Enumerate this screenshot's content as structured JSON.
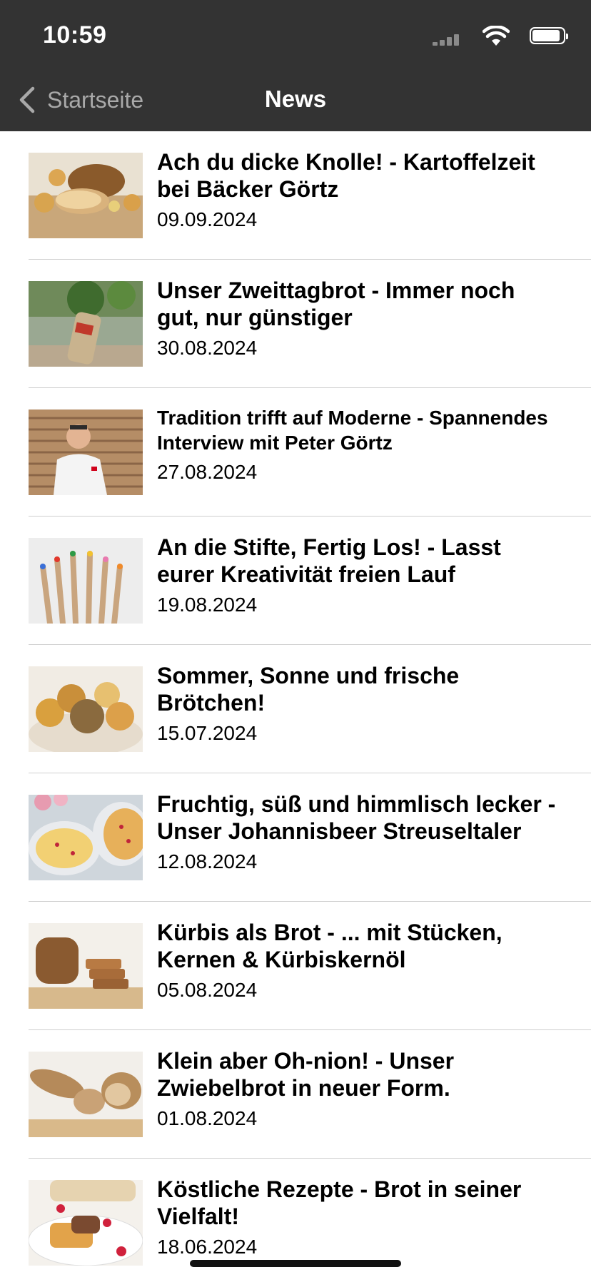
{
  "status_bar": {
    "time": "10:59"
  },
  "nav": {
    "back_label": "Startseite",
    "title": "News"
  },
  "articles": [
    {
      "title": "Ach du dicke Knolle! - Kartoffelzeit bei Bäcker Görtz",
      "date": "09.09.2024",
      "image": "bread-potatoes-image"
    },
    {
      "title": "Unser Zweittagbrot - Immer noch gut, nur günstiger",
      "date": "30.08.2024",
      "image": "bagged-bread-image"
    },
    {
      "title": "Tradition trifft auf Moderne - Spannendes Interview mit Peter Görtz",
      "date": "27.08.2024",
      "image": "baker-portrait-image"
    },
    {
      "title": "An die Stifte, Fertig Los! - Lasst eurer Kreativität freien Lauf",
      "date": "19.08.2024",
      "image": "colored-pencils-image"
    },
    {
      "title": "Sommer, Sonne und frische Brötchen!",
      "date": "15.07.2024",
      "image": "bread-rolls-image"
    },
    {
      "title": "Fruchtig, süß und himmlisch lecker - Unser Johannisbeer Streuseltaler",
      "date": "12.08.2024",
      "image": "streuseltaler-image"
    },
    {
      "title": "Kürbis als Brot - ... mit Stücken, Kernen & Kürbiskernöl",
      "date": "05.08.2024",
      "image": "pumpkin-bread-image"
    },
    {
      "title": "Klein aber Oh-nion! - Unser Zwiebelbrot in neuer Form.",
      "date": "01.08.2024",
      "image": "onion-bread-image"
    },
    {
      "title": "Köstliche Rezepte - Brot in seiner Vielfalt!",
      "date": "18.06.2024",
      "image": "french-toast-image"
    }
  ]
}
